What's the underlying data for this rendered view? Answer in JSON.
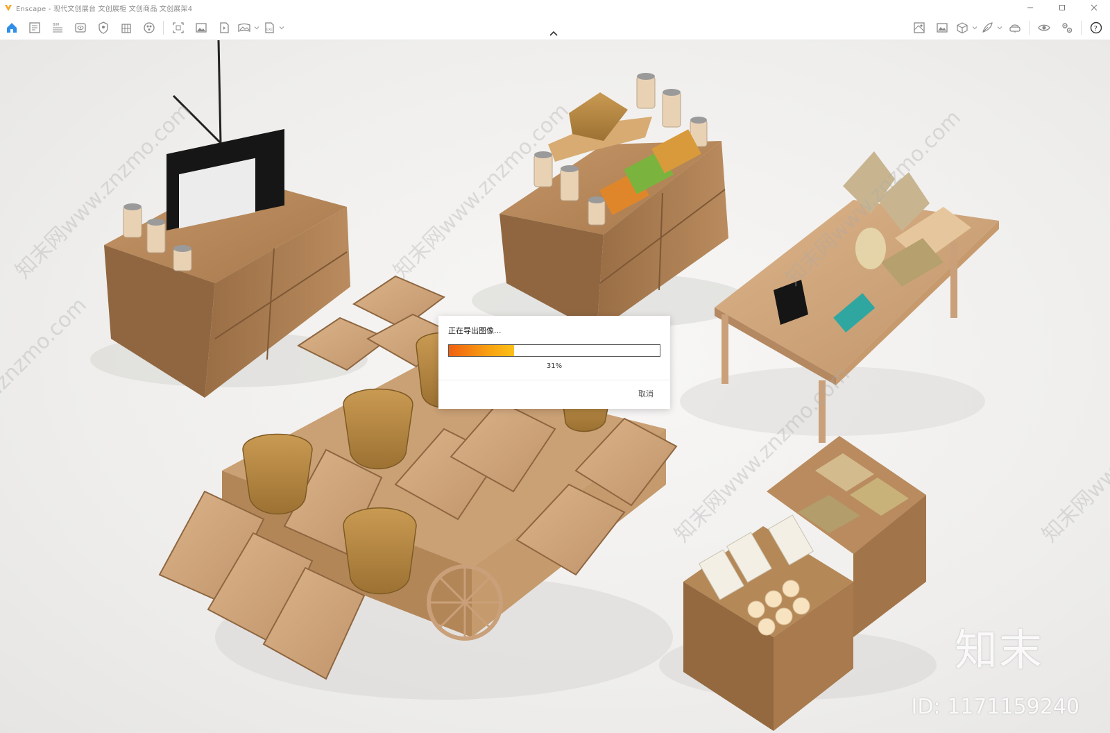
{
  "window": {
    "app_name": "Enscape",
    "title": "Enscape - 现代文创展台 文创展柜 文创商品 文创展架4",
    "controls": {
      "minimize_icon": "minimize-icon",
      "maximize_icon": "maximize-icon",
      "close_icon": "close-icon"
    }
  },
  "toolbar": {
    "left_tools": [
      {
        "icon": "home-icon"
      },
      {
        "icon": "document-list-icon"
      },
      {
        "icon": "bim-icon"
      },
      {
        "icon": "view-icon"
      },
      {
        "icon": "shield-icon"
      },
      {
        "icon": "building-icon"
      },
      {
        "icon": "asset-library-icon"
      },
      {
        "icon": "screenshot-icon"
      },
      {
        "icon": "image-export-icon"
      },
      {
        "icon": "batch-render-icon"
      },
      {
        "icon": "panorama-icon"
      },
      {
        "icon": "exe-export-icon"
      }
    ],
    "right_tools": [
      {
        "icon": "map-icon"
      },
      {
        "icon": "image-settings-icon"
      },
      {
        "icon": "box-icon"
      },
      {
        "icon": "feather-icon"
      },
      {
        "icon": "vr-headset-icon"
      },
      {
        "icon": "eye-icon"
      },
      {
        "icon": "settings-icon"
      },
      {
        "icon": "help-icon"
      }
    ],
    "collapse_icon": "chevron-up-icon"
  },
  "export_dialog": {
    "title": "正在导出图像...",
    "progress_fraction": 0.31,
    "progress_label": "31%",
    "cancel_label": "取消"
  },
  "watermarks": {
    "text": "知末网www.znzmo.com",
    "brand": "知末",
    "id": "ID: 1171159240"
  },
  "colors": {
    "accent": "#f5a623",
    "progress_start": "#f06010",
    "progress_end": "#fcc018",
    "wood": "#b8875a"
  }
}
